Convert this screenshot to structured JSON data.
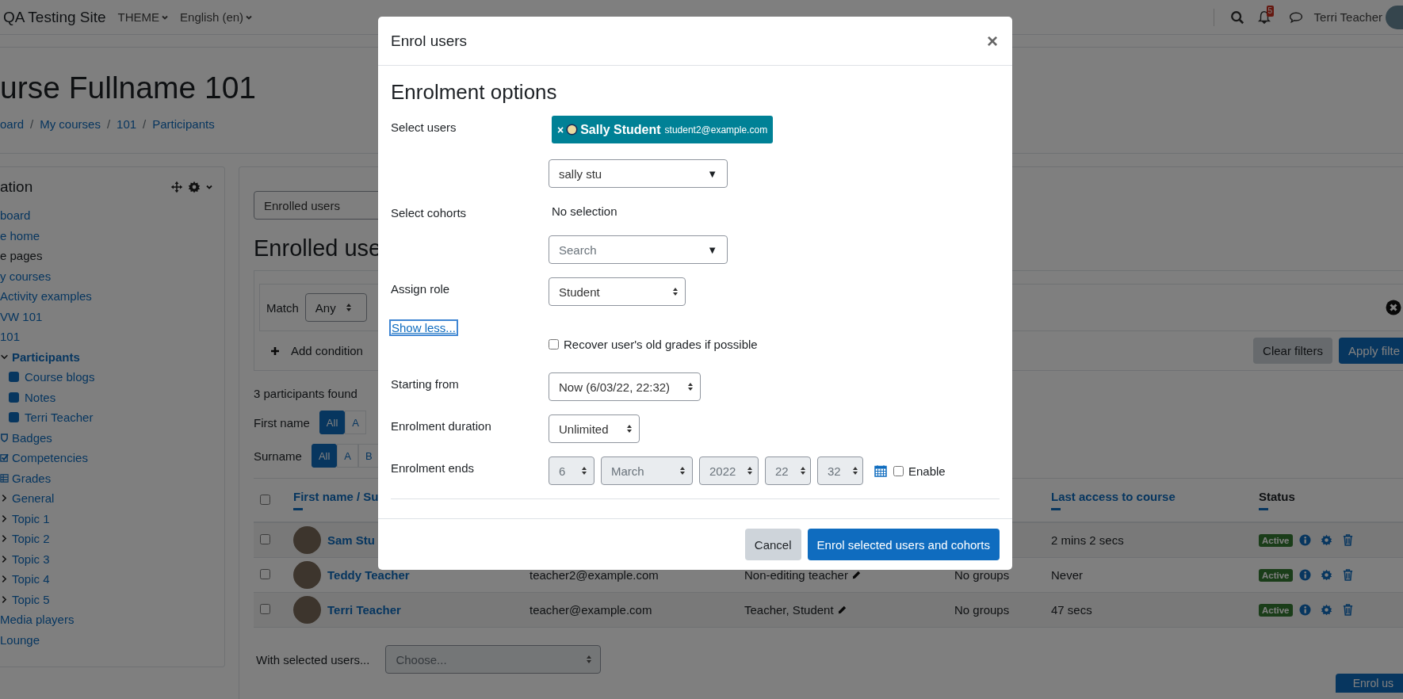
{
  "navbar": {
    "site_name": "QA Testing Site",
    "menus": [
      "THEME",
      "English (en)"
    ],
    "notification_count": "5",
    "user_name": "Terri Teacher"
  },
  "page_header": {
    "title": "urse Fullname 101",
    "breadcrumb": [
      {
        "text": "oard",
        "kind": "link"
      },
      {
        "text": "/",
        "kind": "separator"
      },
      {
        "text": "My courses",
        "kind": "link"
      },
      {
        "text": "/",
        "kind": "separator"
      },
      {
        "text": "101",
        "kind": "link"
      },
      {
        "text": "/",
        "kind": "separator"
      },
      {
        "text": "Participants",
        "kind": "link"
      }
    ]
  },
  "nav_block": {
    "title": "ation",
    "items": [
      {
        "label": "board",
        "kind": "link",
        "active": false
      },
      {
        "label": "e home",
        "kind": "link",
        "active": false
      },
      {
        "label": "e pages",
        "kind": "plain",
        "active": false
      },
      {
        "label": "y courses",
        "kind": "link",
        "active": false
      },
      {
        "label": "Activity examples",
        "kind": "link",
        "active": false
      },
      {
        "label": "VW 101",
        "kind": "link",
        "active": false
      },
      {
        "label": "101",
        "kind": "link",
        "active": false
      },
      {
        "label": "Participants",
        "kind": "node",
        "expanded": true,
        "active": true,
        "children": [
          {
            "label": "Course blogs"
          },
          {
            "label": "Notes"
          },
          {
            "label": "Terri Teacher"
          }
        ]
      },
      {
        "label": "Badges",
        "kind": "badges",
        "active": false
      },
      {
        "label": "Competencies",
        "kind": "competencies",
        "active": false
      },
      {
        "label": "Grades",
        "kind": "grades",
        "active": false
      },
      {
        "label": "General",
        "kind": "node",
        "expanded": false,
        "active": false
      },
      {
        "label": "Topic 1",
        "kind": "node",
        "expanded": false,
        "active": false
      },
      {
        "label": "Topic 2",
        "kind": "node",
        "expanded": false,
        "active": false
      },
      {
        "label": "Topic 3",
        "kind": "node",
        "expanded": false,
        "active": false
      },
      {
        "label": "Topic 4",
        "kind": "node",
        "expanded": false,
        "active": false
      },
      {
        "label": "Topic 5",
        "kind": "node",
        "expanded": false,
        "active": false
      },
      {
        "label": "Media players",
        "kind": "link",
        "active": false
      },
      {
        "label": "Lounge",
        "kind": "link",
        "active": false
      }
    ]
  },
  "main": {
    "view_select": "Enrolled users",
    "heading": "Enrolled use",
    "filter": {
      "match_label": "Match",
      "match_value": "Any",
      "add_condition": "Add condition",
      "clear": "Clear filters",
      "apply": "Apply filte"
    },
    "count": "3 participants found",
    "initials": [
      {
        "label": "First name",
        "letters": [
          {
            "text": "All",
            "selected": true
          },
          {
            "text": "A",
            "selected": false
          }
        ]
      },
      {
        "label": "Surname",
        "letters": [
          {
            "text": "All",
            "selected": true
          },
          {
            "text": "A",
            "selected": false
          },
          {
            "text": "B",
            "selected": false
          }
        ]
      }
    ],
    "table": {
      "select_all_checked": false,
      "columns": [
        {
          "label": "First name / Su"
        },
        {
          "label": "Last access to course"
        },
        {
          "label": "Status"
        }
      ],
      "rows": [
        {
          "name": "Sam Stu",
          "last_access": "2 mins 2 secs",
          "status": "Active",
          "checked": false
        },
        {
          "name": "Teddy Teacher",
          "email": "teacher2@example.com",
          "roles": "Non-editing teacher",
          "groups": "No groups",
          "last_access": "Never",
          "status": "Active",
          "checked": false
        },
        {
          "name": "Terri Teacher",
          "email": "teacher@example.com",
          "roles": "Teacher, Student",
          "groups": "No groups",
          "last_access": "47 secs",
          "status": "Active",
          "checked": false
        }
      ]
    },
    "bulk": {
      "label": "With selected users...",
      "placeholder": "Choose..."
    },
    "enrol_button": "Enrol us"
  },
  "modal": {
    "title": "Enrol users",
    "close": "×",
    "heading": "Enrolment options",
    "fields": [
      {
        "kind": "autocomplete",
        "label": "Select users",
        "chips": [
          {
            "remove": "×",
            "name": "Sally Student",
            "email": "student2@example.com"
          }
        ],
        "value": "sally stu",
        "arrow": "▼"
      },
      {
        "kind": "autocomplete",
        "label": "Select cohorts",
        "empty_text": "No selection",
        "placeholder": "Search",
        "arrow": "▼"
      },
      {
        "kind": "select",
        "label": "Assign role",
        "value": "Student"
      },
      {
        "kind": "toggle",
        "text": "Show less..."
      },
      {
        "kind": "checkbox",
        "label": "Recover user's old grades if possible",
        "checked": false
      },
      {
        "kind": "select",
        "label": "Starting from",
        "value": "Now (6/03/22, 22:32)"
      },
      {
        "kind": "select",
        "label": "Enrolment duration",
        "value": "Unlimited"
      },
      {
        "kind": "date",
        "label": "Enrolment ends",
        "parts": [
          "6",
          "March",
          "2022",
          "22",
          "32"
        ],
        "disabled": true,
        "enable_label": "Enable",
        "enabled": false
      }
    ],
    "buttons": [
      {
        "label": "Cancel",
        "kind": "secondary"
      },
      {
        "label": "Enrol selected users and cohorts",
        "kind": "primary"
      }
    ]
  }
}
